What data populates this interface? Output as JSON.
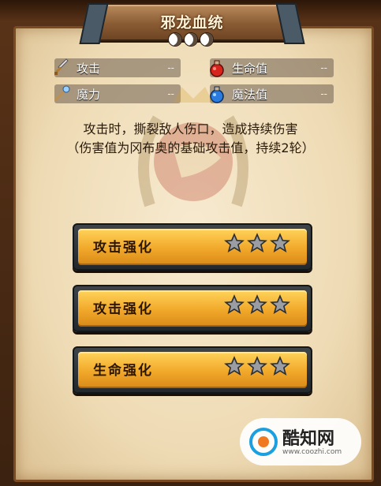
{
  "title": "邪龙血统",
  "moons_count": 3,
  "stats": [
    {
      "icon": "sword-icon",
      "label": "攻击",
      "value": "--"
    },
    {
      "icon": "red-potion-icon",
      "label": "生命值",
      "value": "--"
    },
    {
      "icon": "magic-staff-icon",
      "label": "魔力",
      "value": "--"
    },
    {
      "icon": "blue-potion-icon",
      "label": "魔法值",
      "value": "--"
    }
  ],
  "description": {
    "line1": "攻击时，撕裂敌人伤口，造成持续伤害",
    "line2": "（伤害值为冈布奥的基础攻击值，持续2轮）"
  },
  "upgrades": [
    {
      "label": "攻击强化",
      "stars": 3
    },
    {
      "label": "攻击强化",
      "stars": 3
    },
    {
      "label": "生命强化",
      "stars": 3
    }
  ],
  "watermark": {
    "name": "酷知网",
    "url": "www.coozhi.com"
  },
  "colors": {
    "gold": "#f1a82a",
    "parchment": "#efdcb6",
    "frame": "#5a3318"
  }
}
